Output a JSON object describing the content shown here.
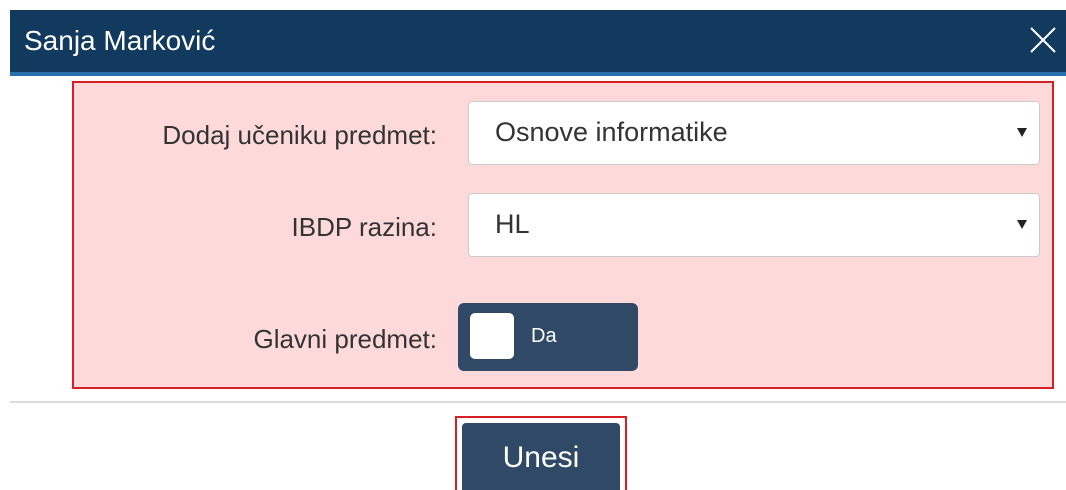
{
  "dialog": {
    "title": "Sanja Marković",
    "close_icon": "close-icon"
  },
  "form": {
    "subject": {
      "label": "Dodaj učeniku predmet:",
      "value": "Osnove informatike"
    },
    "level": {
      "label": "IBDP razina:",
      "value": "HL"
    },
    "main_subject": {
      "label": "Glavni predmet:",
      "toggle_text": "Da",
      "checked": true
    }
  },
  "footer": {
    "submit_label": "Unesi"
  },
  "colors": {
    "header_bg": "#123a5e",
    "header_accent": "#2a6fae",
    "highlight_bg": "#fdd9da",
    "highlight_border": "#d71f26",
    "button_bg": "#2f4966"
  }
}
